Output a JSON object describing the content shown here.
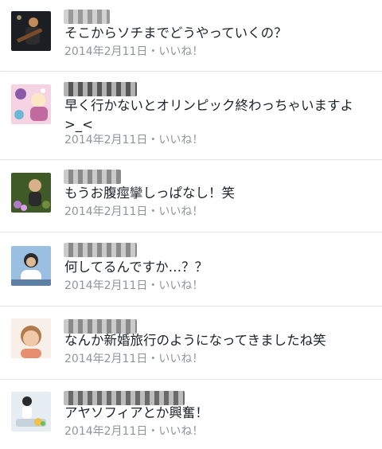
{
  "comments": [
    {
      "text": "そこからソチまでどうやっていくの？",
      "date": "2014年2月11日",
      "separator": "・",
      "like": "いいね！",
      "avatar_colors": [
        "#2b2b2b",
        "#7a4a2a"
      ],
      "name_color": "#9a9a9a"
    },
    {
      "text": "早く行かないとオリンピック終わっちゃいますよ",
      "text2": ">_<",
      "date": "2014年2月11日",
      "separator": "・",
      "like": "いいね！",
      "avatar_colors": [
        "#f4c6d8",
        "#6a3f7a"
      ],
      "name_color": "#555555"
    },
    {
      "text": "もうお腹痙攣しっぱなし！笑",
      "date": "2014年2月11日",
      "separator": "・",
      "like": "いいね！",
      "avatar_colors": [
        "#4a6b2e",
        "#b07ac7"
      ],
      "name_color": "#8a8a8a"
    },
    {
      "text": "何してるんですか…？？",
      "date": "2014年2月11日",
      "separator": "・",
      "like": "いいね！",
      "avatar_colors": [
        "#8fb3d9",
        "#2b2b2b"
      ],
      "name_color": "#8a8a8a"
    },
    {
      "text": "なんか新婚旅行のようになってきましたね笑",
      "date": "2014年2月11日",
      "separator": "・",
      "like": "いいね！",
      "avatar_colors": [
        "#f3e6dc",
        "#e7b894"
      ],
      "name_color": "#8a8a8a"
    },
    {
      "text": "アヤソフィアとか興奮！",
      "date": "2014年2月11日",
      "separator": "・",
      "like": "いいね！",
      "avatar_colors": [
        "#dfe9f0",
        "#f2c14a"
      ],
      "name_color": "#6a6a6a"
    }
  ]
}
